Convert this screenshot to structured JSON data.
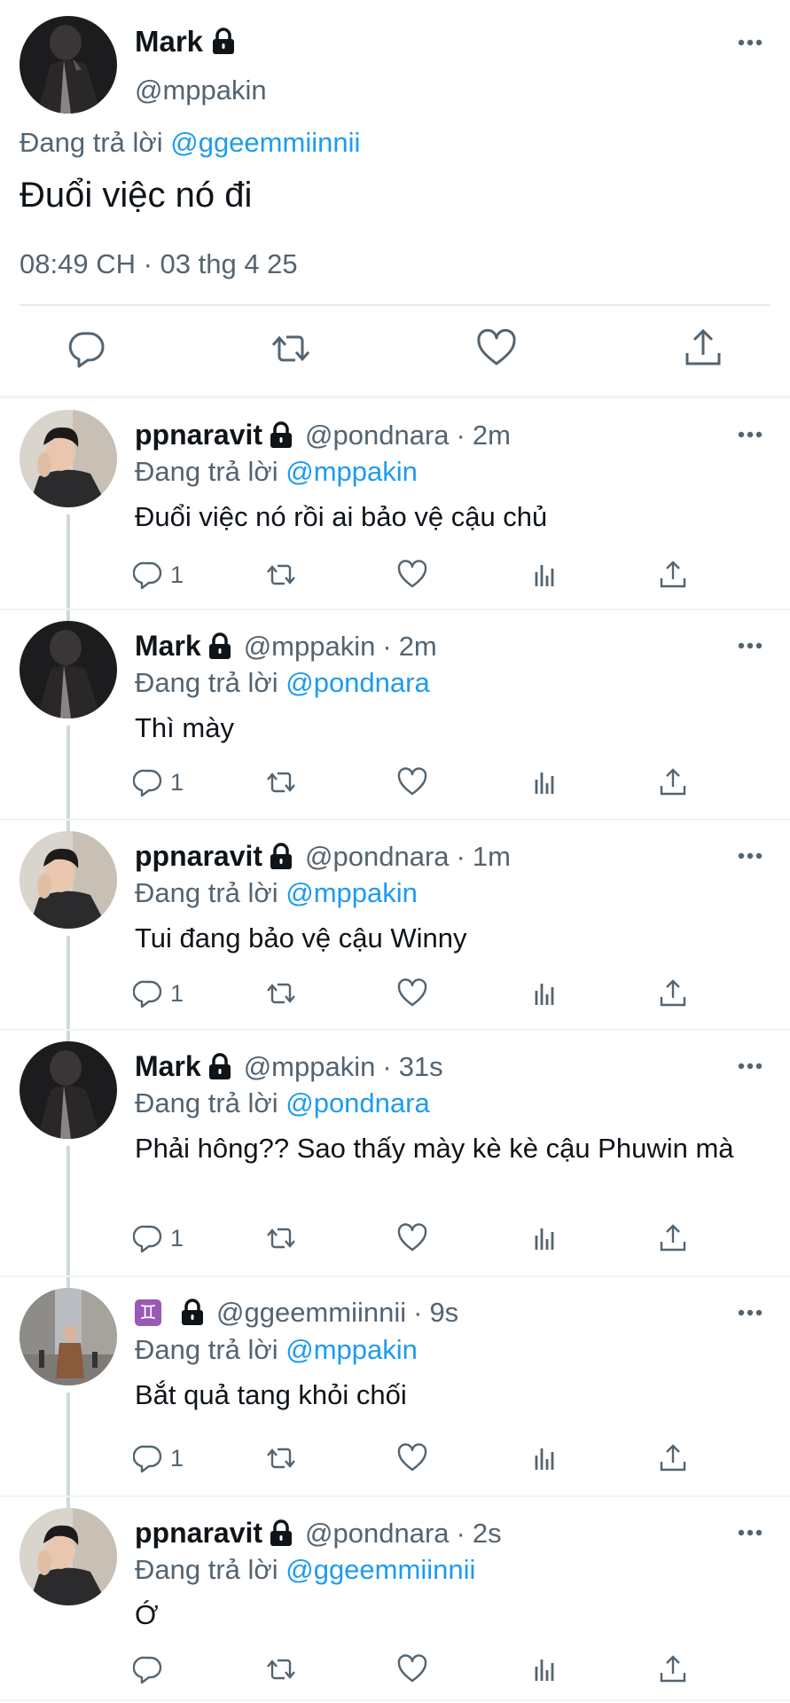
{
  "main_tweet": {
    "name": "Mark",
    "handle": "@mppakin",
    "reply_prefix": "Đang trả lời ",
    "reply_mention": "@ggeemmiinnii",
    "text": "Đuổi việc nó đi",
    "timestamp": "08:49 CH · 03 thg 4 25",
    "actions": [
      "reply-icon",
      "retweet-icon",
      "like-icon",
      "share-icon"
    ]
  },
  "replies": [
    {
      "name": "ppnaravit",
      "handle": "@pondnara",
      "age": "2m",
      "reply_prefix": "Đang trả lời ",
      "reply_mention": "@mppakin",
      "text": "Đuổi việc nó rồi ai bảo vệ cậu chủ",
      "reply_count": "1",
      "avatar": "pond"
    },
    {
      "name": "Mark",
      "handle": "@mppakin",
      "age": "2m",
      "reply_prefix": "Đang trả lời ",
      "reply_mention": "@pondnara",
      "text": "Thì mày",
      "reply_count": "1",
      "avatar": "mark"
    },
    {
      "name": "ppnaravit",
      "handle": "@pondnara",
      "age": "1m",
      "reply_prefix": "Đang trả lời ",
      "reply_mention": "@mppakin",
      "text": "Tui đang bảo vệ cậu Winny",
      "reply_count": "1",
      "avatar": "pond"
    },
    {
      "name": "Mark",
      "handle": "@mppakin",
      "age": "31s",
      "reply_prefix": "Đang trả lời ",
      "reply_mention": "@pondnara",
      "text": "Phải hông?? Sao thấy mày kè kè cậu Phuwin mà",
      "reply_count": "1",
      "avatar": "mark"
    },
    {
      "name": "♊",
      "handle": "@ggeemmiinnii",
      "age": "9s",
      "reply_prefix": "Đang trả lời ",
      "reply_mention": "@mppakin",
      "text": "Bắt quả tang khỏi chối",
      "reply_count": "1",
      "avatar": "gem"
    },
    {
      "name": "ppnaravit",
      "handle": "@pondnara",
      "age": "2s",
      "reply_prefix": "Đang trả lời ",
      "reply_mention": "@ggeemmiinnii",
      "text": "Ớ",
      "reply_count": "",
      "avatar": "pond"
    }
  ],
  "colors": {
    "text": "#0f1419",
    "secondary": "#536471",
    "link": "#1d9bf0",
    "divider": "#eff3f4",
    "gemini_badge": "#9b59b6"
  }
}
